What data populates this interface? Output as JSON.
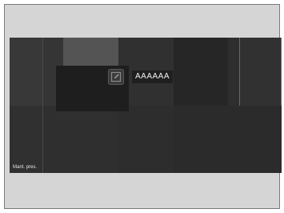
{
  "tile": {
    "label": "AAAAAA",
    "icon": "edit-icon"
  },
  "caption": "Mant. pres."
}
